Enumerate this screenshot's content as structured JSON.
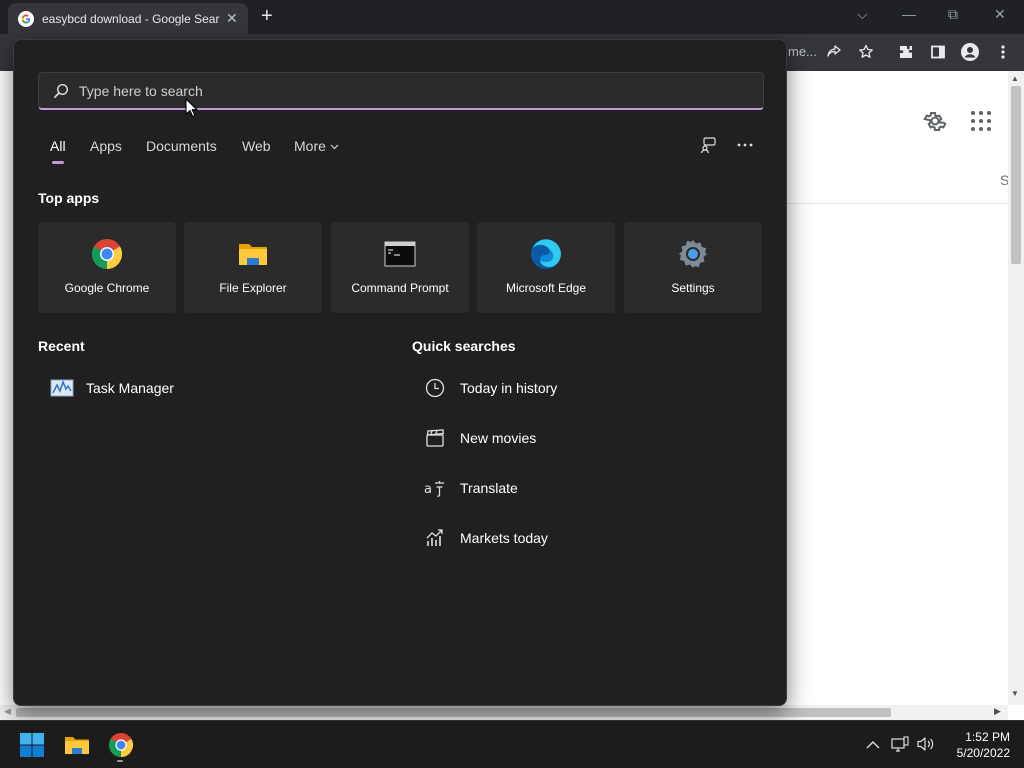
{
  "browser": {
    "tab_title": "easybcd download - Google Search",
    "tab_close": "✕",
    "new_tab": "+",
    "window_controls": {
      "tab_search": "⌵",
      "minimize": "—",
      "restore": "⧉",
      "close": "✕"
    },
    "omnibox_fragment": "me..."
  },
  "page": {
    "side_letter": "S"
  },
  "search_panel": {
    "search_placeholder": "Type here to search",
    "filter_tabs": [
      "All",
      "Apps",
      "Documents",
      "Web",
      "More"
    ],
    "active_tab": "All",
    "top_apps_title": "Top apps",
    "top_apps": [
      {
        "label": "Google Chrome",
        "icon": "chrome-icon"
      },
      {
        "label": "File Explorer",
        "icon": "folder-icon"
      },
      {
        "label": "Command Prompt",
        "icon": "command-prompt-icon"
      },
      {
        "label": "Microsoft Edge",
        "icon": "edge-icon"
      },
      {
        "label": "Settings",
        "icon": "gear-icon"
      }
    ],
    "recent_title": "Recent",
    "recent_items": [
      {
        "label": "Task Manager",
        "icon": "task-manager-icon"
      }
    ],
    "quick_searches_title": "Quick searches",
    "quick_searches": [
      {
        "label": "Today in history",
        "icon": "clock-icon"
      },
      {
        "label": "New movies",
        "icon": "clapperboard-icon"
      },
      {
        "label": "Translate",
        "icon": "translate-icon"
      },
      {
        "label": "Markets today",
        "icon": "chart-icon"
      }
    ],
    "accent_color": "#c19adb"
  },
  "taskbar": {
    "time": "1:52 PM",
    "date": "5/20/2022"
  }
}
